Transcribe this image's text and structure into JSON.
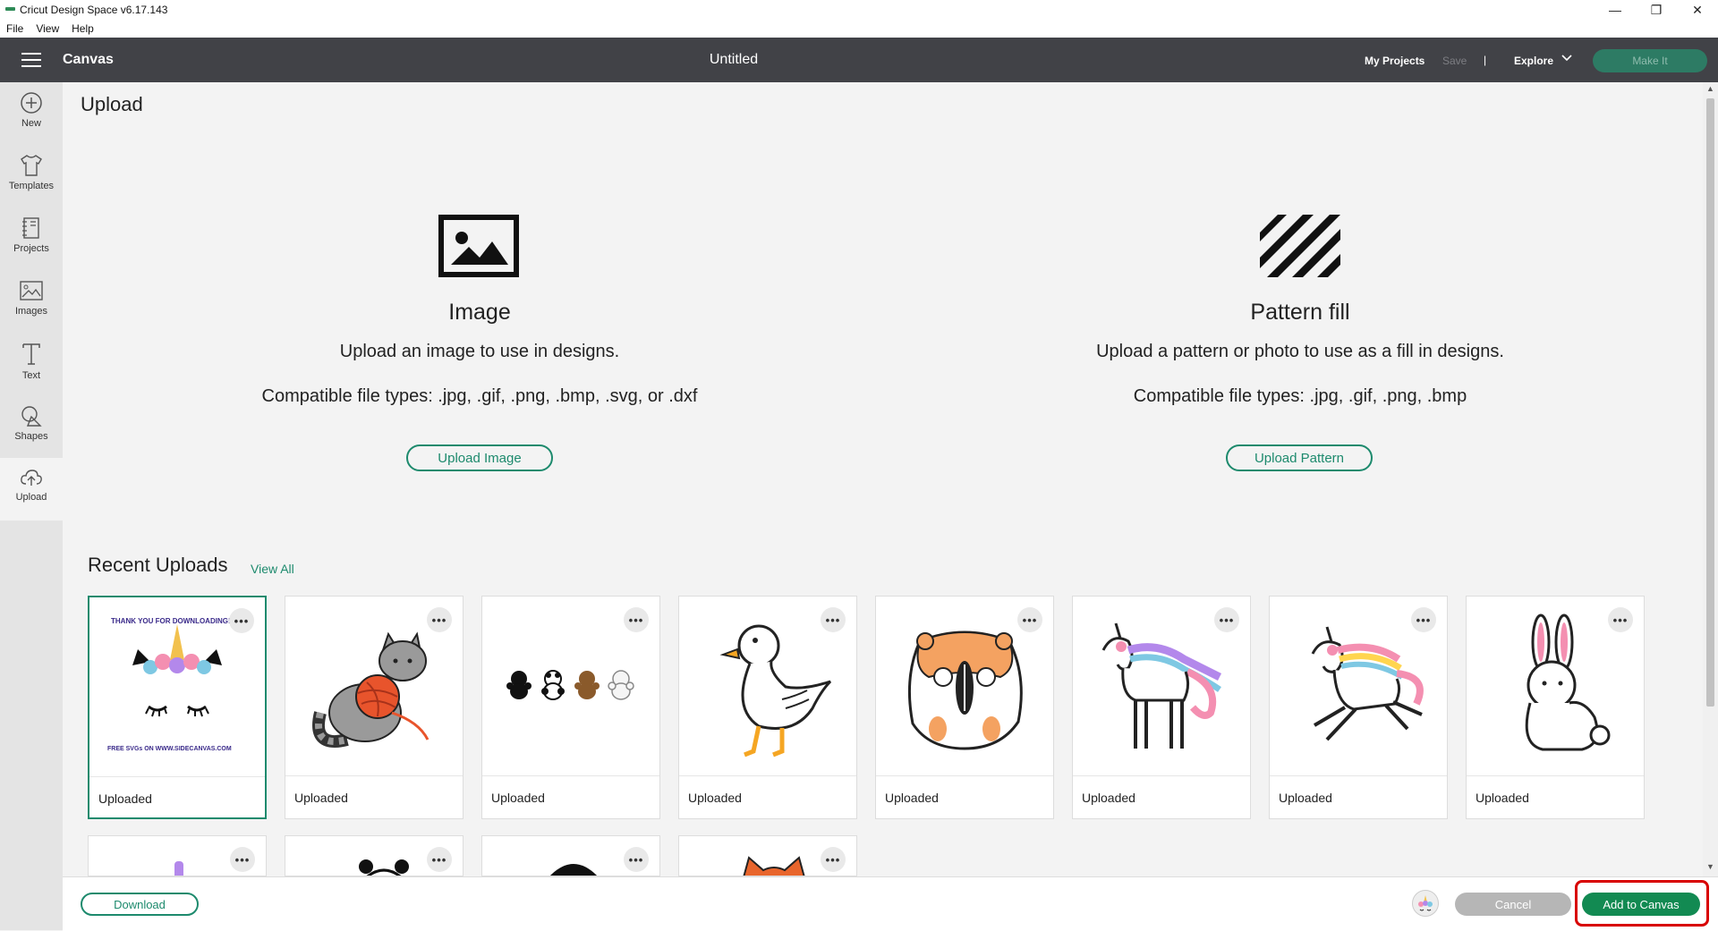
{
  "window": {
    "title": "Cricut Design Space  v6.17.143",
    "controls": [
      "minimize-icon",
      "restore-icon",
      "close-icon"
    ]
  },
  "menubar": {
    "items": [
      "File",
      "View",
      "Help"
    ]
  },
  "header": {
    "section": "Canvas",
    "doc_title": "Untitled",
    "my_projects": "My Projects",
    "save": "Save",
    "separator": "|",
    "explore": "Explore",
    "make_it": "Make It"
  },
  "sidebar": {
    "items": [
      {
        "label": "New",
        "icon": "plus-circle-icon"
      },
      {
        "label": "Templates",
        "icon": "tshirt-icon"
      },
      {
        "label": "Projects",
        "icon": "notebook-icon"
      },
      {
        "label": "Images",
        "icon": "image-icon"
      },
      {
        "label": "Text",
        "icon": "text-icon"
      },
      {
        "label": "Shapes",
        "icon": "shapes-icon"
      },
      {
        "label": "Upload",
        "icon": "cloud-upload-icon"
      }
    ],
    "active": "Upload"
  },
  "main": {
    "title": "Upload",
    "image_panel": {
      "heading": "Image",
      "desc": "Upload an image to use in designs.",
      "types": "Compatible file types: .jpg, .gif, .png, .bmp, .svg, or .dxf",
      "button": "Upload Image"
    },
    "pattern_panel": {
      "heading": "Pattern fill",
      "desc": "Upload a pattern or photo to use as a fill in designs.",
      "types": "Compatible file types: .jpg, .gif, .png, .bmp",
      "button": "Upload Pattern"
    },
    "recent": {
      "title": "Recent Uploads",
      "view_all": "View All",
      "cards": [
        {
          "label": "Uploaded",
          "thumb": "unicorn-face",
          "top_text": "THANK YOU FOR DOWNLOADING!",
          "bottom_text": "FREE SVGs ON WWW.SIDECANVAS.COM",
          "selected": true
        },
        {
          "label": "Uploaded",
          "thumb": "cat-with-yarn"
        },
        {
          "label": "Uploaded",
          "thumb": "bears"
        },
        {
          "label": "Uploaded",
          "thumb": "duck"
        },
        {
          "label": "Uploaded",
          "thumb": "hamster"
        },
        {
          "label": "Uploaded",
          "thumb": "unicorn-standing"
        },
        {
          "label": "Uploaded",
          "thumb": "unicorn-running"
        },
        {
          "label": "Uploaded",
          "thumb": "bunny"
        }
      ],
      "more_icon": "more-dots-icon"
    }
  },
  "bottombar": {
    "download": "Download",
    "cancel": "Cancel",
    "add_to_canvas": "Add to Canvas"
  },
  "colors": {
    "header": "#414247",
    "accent": "#1d8a6d",
    "add_button": "#128a52",
    "highlight": "#d80000"
  }
}
